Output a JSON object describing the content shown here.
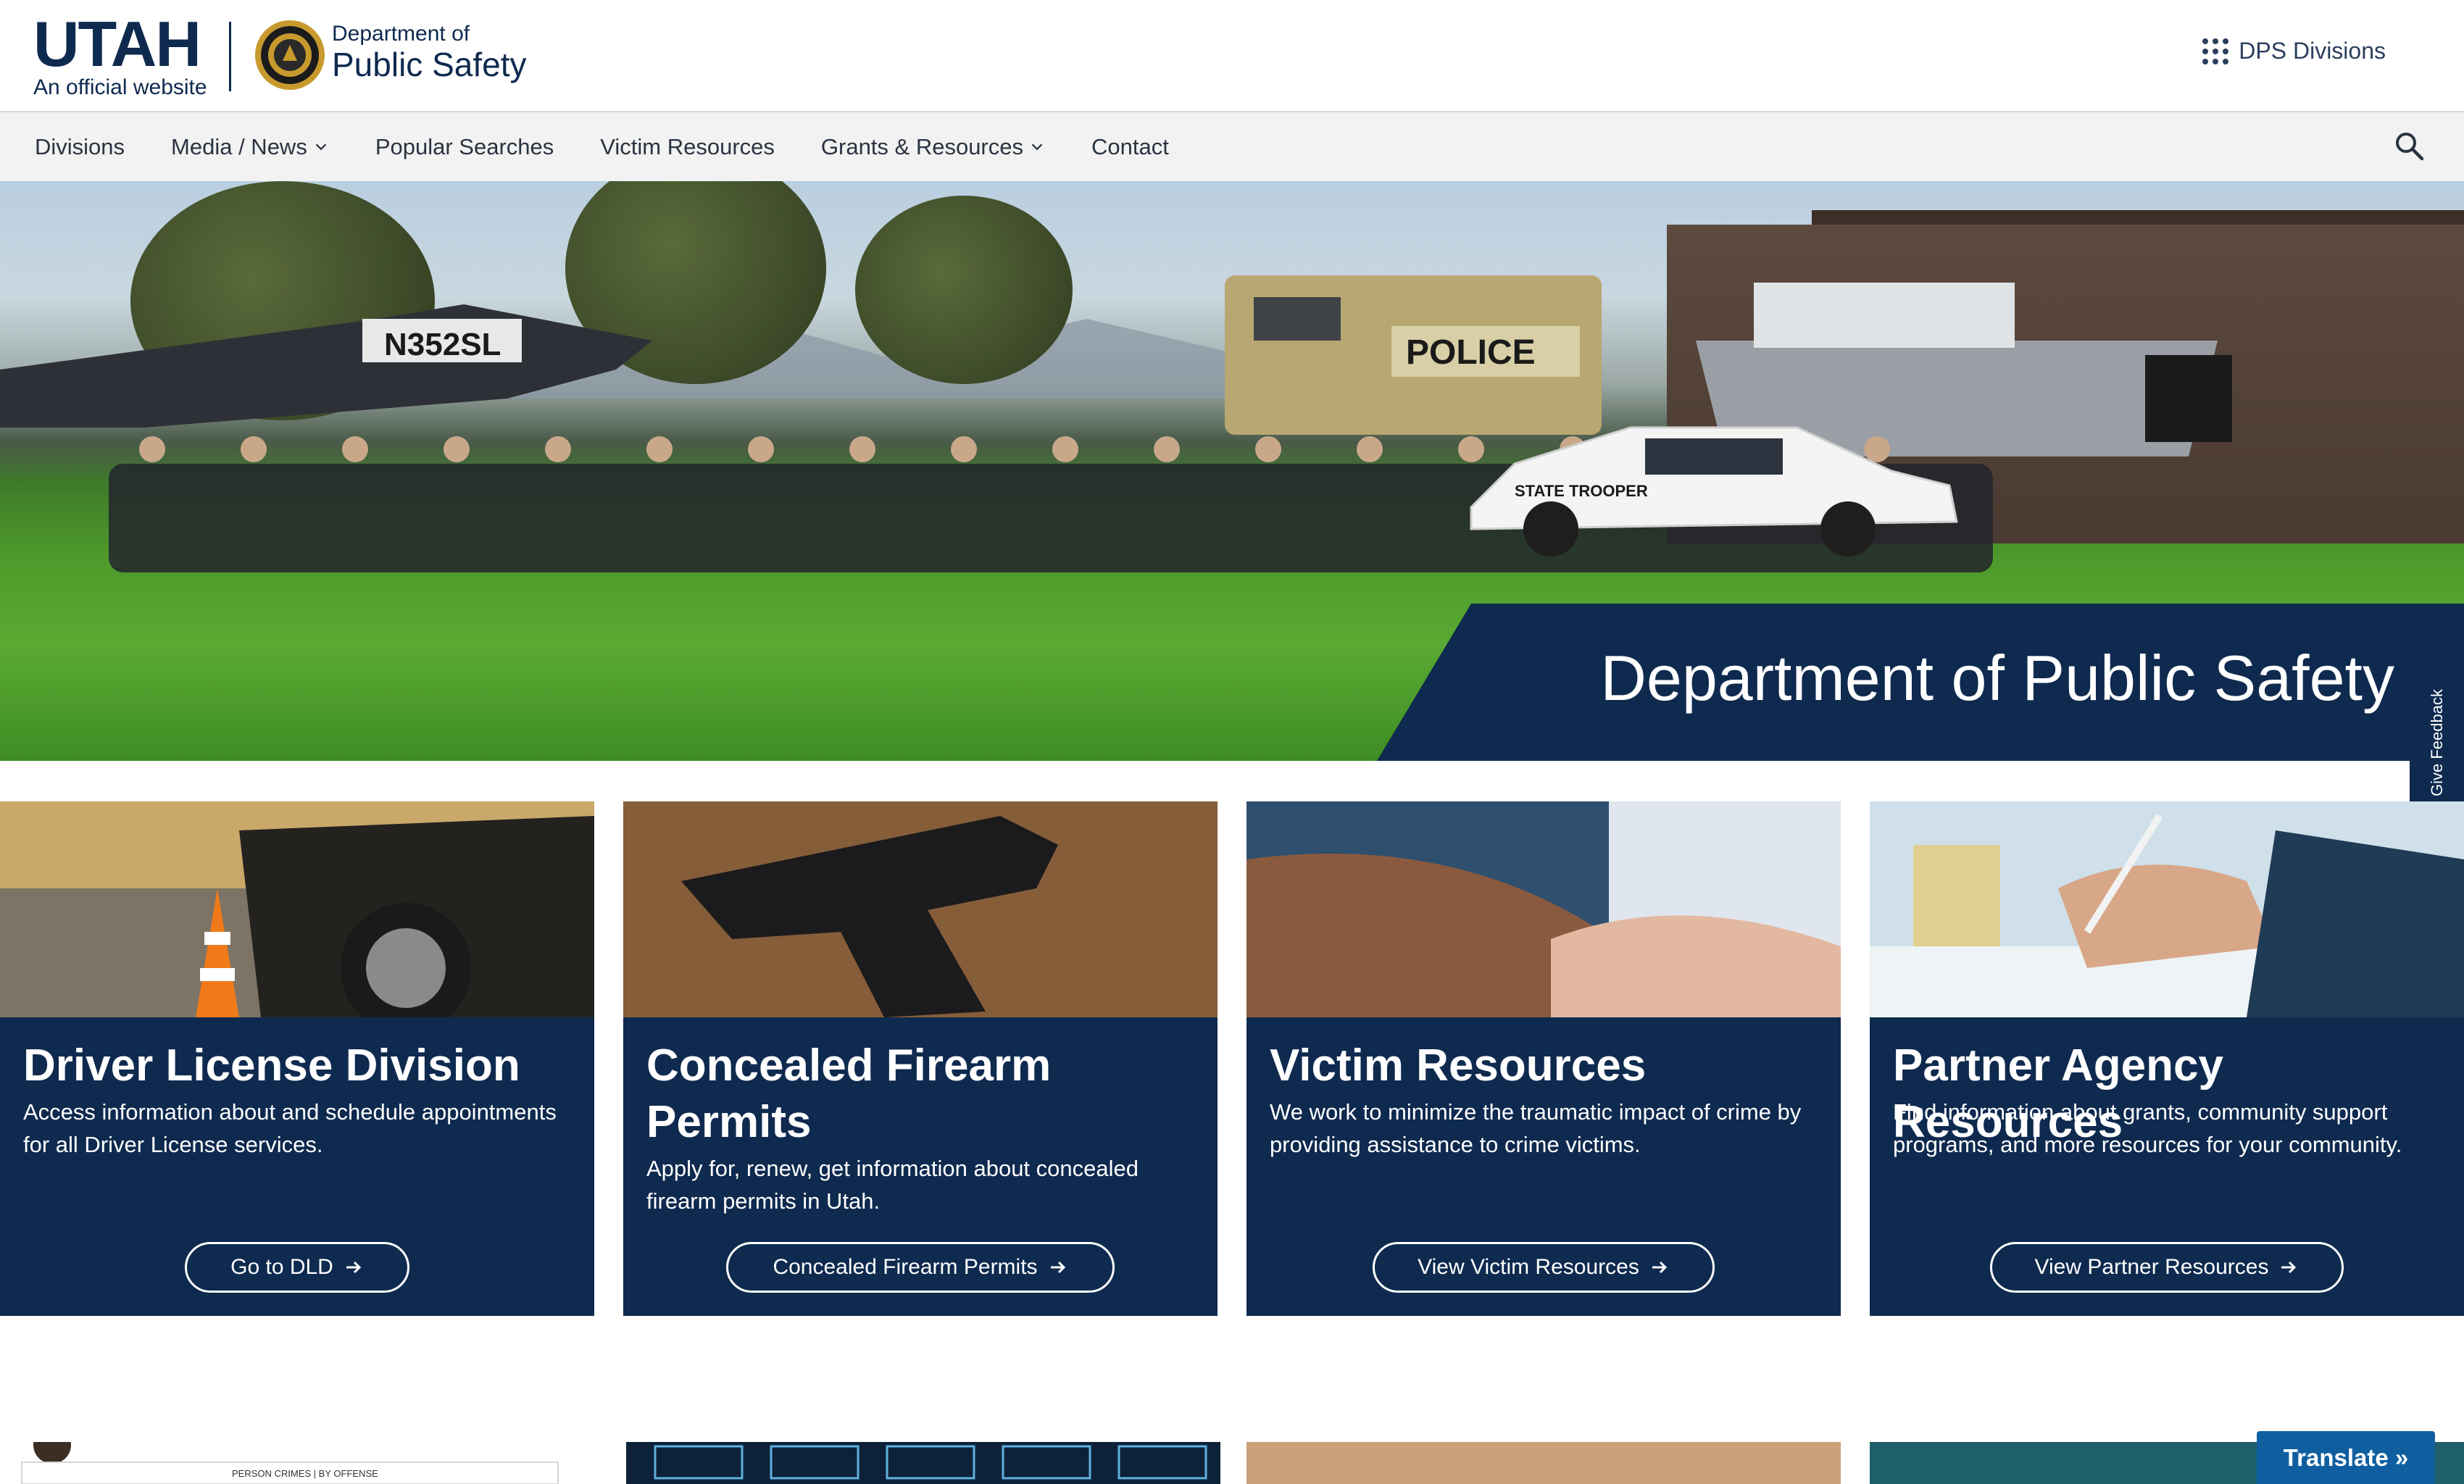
{
  "header": {
    "utah_word": "UTAH",
    "utah_sub": "An official website",
    "dept_of": "Department of",
    "public_safety": "Public Safety",
    "dps_divisions_label": "DPS Divisions"
  },
  "nav": {
    "items": [
      {
        "label": "Divisions",
        "has_dropdown": false
      },
      {
        "label": "Media / News",
        "has_dropdown": true
      },
      {
        "label": "Popular Searches",
        "has_dropdown": false
      },
      {
        "label": "Victim Resources",
        "has_dropdown": false
      },
      {
        "label": "Grants & Resources",
        "has_dropdown": true
      },
      {
        "label": "Contact",
        "has_dropdown": false
      }
    ],
    "search_icon": "search-icon"
  },
  "hero": {
    "title": "Department of Public Safety",
    "vehicle_marks": {
      "helicopter_tail": "N352SL",
      "armored_vehicle": "POLICE",
      "car": "STATE TROOPER"
    }
  },
  "feedback": {
    "label": "Give Feedback"
  },
  "cards": [
    {
      "title": "Driver License Division",
      "description": "Access information about and schedule appointments for all Driver License services.",
      "button": "Go to DLD"
    },
    {
      "title": "Concealed Firearm Permits",
      "description": "Apply for, renew, get information about concealed firearm permits in Utah.",
      "button": "Concealed Firearm Permits"
    },
    {
      "title": "Victim Resources",
      "description": "We work to minimize the traumatic impact of crime by providing assistance to crime victims.",
      "button": "View Victim Resources"
    },
    {
      "title": "Partner Agency Resources",
      "description": "Find information about grants, community support programs, and more resources for your community.",
      "button": "View Partner Resources"
    }
  ],
  "bottom": {
    "first_card_caption": "PERSON CRIMES | BY OFFENSE"
  },
  "translate": {
    "label": "Translate »"
  },
  "colors": {
    "navy": "#0f2a4f",
    "nav_bg": "#f2f2f2",
    "translate_blue": "#0f5fa0"
  }
}
